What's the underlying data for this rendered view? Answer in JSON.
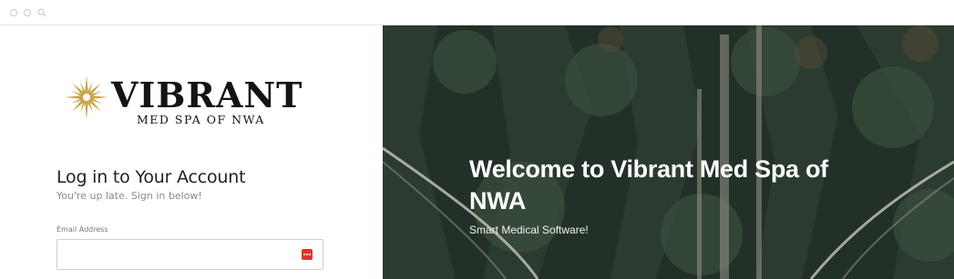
{
  "logo": {
    "name": "VIBRANT",
    "subtitle": "MED SPA OF NWA"
  },
  "login": {
    "title": "Log in to Your Account",
    "subtitle": "You're up late. Sign in below!",
    "email_label": "Email Address",
    "email_value": "",
    "password_manager_icon": "password-manager-icon"
  },
  "hero": {
    "welcome": "Welcome to Vibrant Med Spa of NWA",
    "tagline": "Smart Medical Software!"
  },
  "colors": {
    "accent_red": "#d9362e",
    "logo_gold": "#c9a54a",
    "text_dark": "#222222"
  }
}
